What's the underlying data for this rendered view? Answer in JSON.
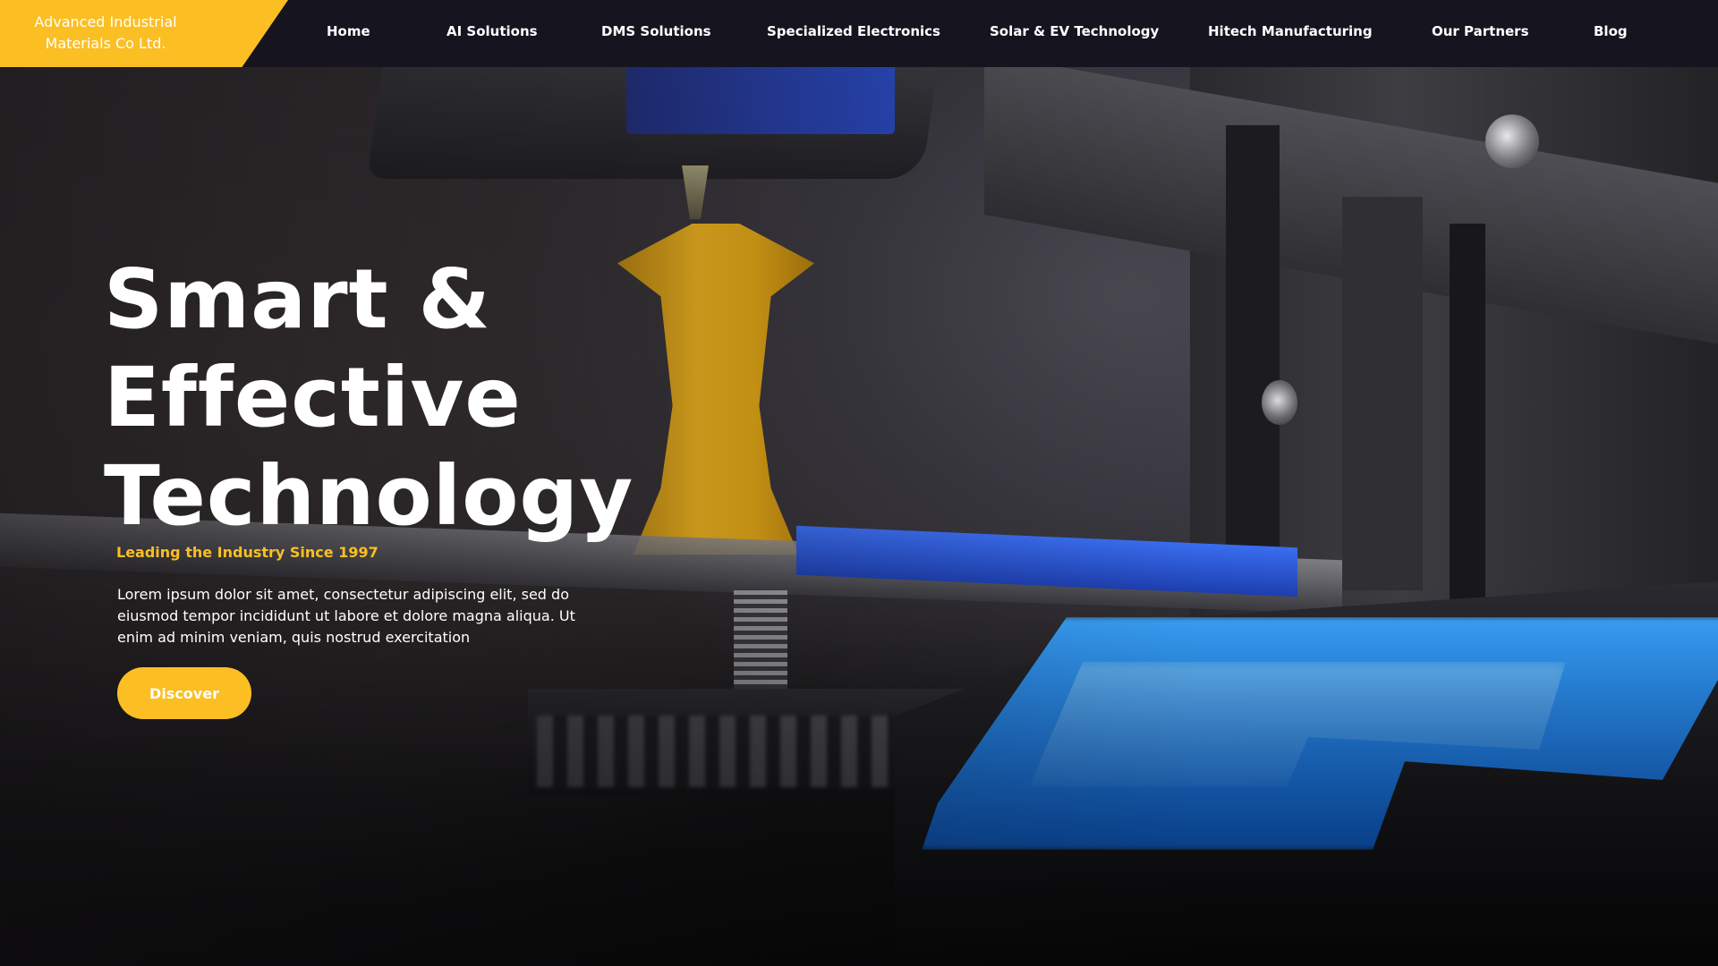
{
  "brand": {
    "line1": "Advanced Industrial",
    "line2": "Materials Co Ltd.",
    "color": "#fbbf24"
  },
  "nav": {
    "items": [
      {
        "label": "Home"
      },
      {
        "label": "AI Solutions"
      },
      {
        "label": "DMS Solutions"
      },
      {
        "label": "Specialized Electronics"
      },
      {
        "label": "Solar & EV Technology"
      },
      {
        "label": "Hitech Manufacturing"
      },
      {
        "label": "Our Partners"
      },
      {
        "label": "Blog"
      }
    ]
  },
  "hero": {
    "title_lines": [
      "Smart &",
      "Effective",
      "Technology"
    ],
    "tagline": "Leading the Industry Since 1997",
    "description": "Lorem ipsum dolor sit amet, consectetur adipiscing elit, sed do eiusmod tempor incididunt ut labore et dolore magna aliqua. Ut enim ad minim veniam, quis nostrud exercitation",
    "cta_label": "Discover",
    "accent_color": "#fbbf24"
  }
}
